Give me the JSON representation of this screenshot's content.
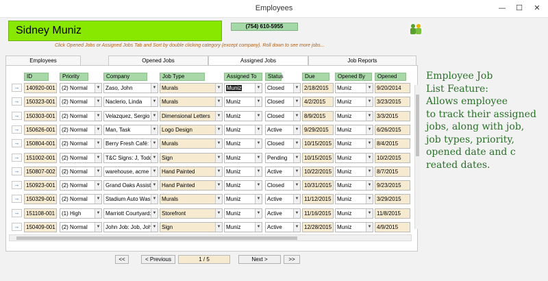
{
  "window": {
    "title": "Employees",
    "min": "—",
    "max": "☐",
    "close": "✕"
  },
  "employee": {
    "name": "Sidney Muniz",
    "phone": "(754) 610-5955"
  },
  "hint": "Click  Opened Jobs or Assigned Jobs Tab and Sort by double clicking category (except company).  Roll down to see more jobs...",
  "tabs": [
    "Employees",
    "Opened Jobs",
    "Assigned Jobs",
    "Job Reports"
  ],
  "active_tab": "Assigned Jobs",
  "columns": [
    "ID",
    "Priority",
    "Company",
    "Job Type",
    "Assigned To",
    "Status",
    "Due",
    "Opened By",
    "Opened"
  ],
  "rows": [
    [
      "140920-001",
      "(2) Normal",
      "Zaso, John",
      "Murals",
      "Muniz",
      "Closed",
      "2/18/2015",
      "Muniz",
      "9/20/2014"
    ],
    [
      "150323-001",
      "(2) Normal",
      "Naclerio, Linda",
      "Murals",
      "Muniz",
      "Closed",
      "4/2/2015",
      "Muniz",
      "3/23/2015"
    ],
    [
      "150303-001",
      "(2) Normal",
      "Velazquez, Sergio",
      "Dimensional Letters",
      "Muniz",
      "Closed",
      "8/9/2015",
      "Muniz",
      "3/3/2015"
    ],
    [
      "150626-001",
      "(2) Normal",
      "Man, Task",
      "Logo Design",
      "Muniz",
      "Active",
      "9/29/2015",
      "Muniz",
      "6/26/2015"
    ],
    [
      "150804-001",
      "(2) Normal",
      "Berry Fresh Café: Tin",
      "Murals",
      "Muniz",
      "Closed",
      "10/15/2015",
      "Muniz",
      "8/4/2015"
    ],
    [
      "151002-001",
      "(2) Normal",
      "T&C Signs: J, Todd",
      "Sign",
      "Muniz",
      "Pending",
      "10/15/2015",
      "Muniz",
      "10/2/2015"
    ],
    [
      "150807-002",
      "(2) Normal",
      "warehouse, acme",
      "Hand Painted",
      "Muniz",
      "Active",
      "10/22/2015",
      "Muniz",
      "8/7/2015"
    ],
    [
      "150923-001",
      "(2) Normal",
      "Grand Oaks Assistec",
      "Hand Painted",
      "Muniz",
      "Closed",
      "10/31/2015",
      "Muniz",
      "9/23/2015"
    ],
    [
      "150329-001",
      "(2) Normal",
      "Stadium Auto Wash",
      "Murals",
      "Muniz",
      "Active",
      "11/12/2015",
      "Muniz",
      "3/29/2015"
    ],
    [
      "151108-001",
      "(1) High",
      "Marriott Courtyard:",
      "Storefront",
      "Muniz",
      "Active",
      "11/16/2015",
      "Muniz",
      "11/8/2015"
    ],
    [
      "150409-001",
      "(2) Normal",
      "John Job: Job, John",
      "Sign",
      "Muniz",
      "Active",
      "12/28/2015",
      "Muniz",
      "4/9/2015"
    ]
  ],
  "row_selector_icon": "→",
  "dropdown_icon": "▼",
  "feature_text": "Employee Job List Feature: Allows employee to track their assigned jobs, along with job, job types, priority, opened date and c reated dates.",
  "feature_lines": [
    "Employee Job",
    "List Feature:",
    "Allows employee",
    "to track their assigned",
    "jobs, along with job,",
    "job types, priority,",
    "opened date and c",
    "reated dates."
  ],
  "nav": {
    "first": "<<",
    "previous": "< Previous",
    "page": "1 / 5",
    "next": "Next >",
    "last": ">>"
  },
  "colors": {
    "name_bg": "#89e800",
    "header_bg": "#a8d8a8",
    "feature_text": "#2a7028",
    "hint_text": "#b06018",
    "text_cell_bg": "#f6ead0"
  }
}
